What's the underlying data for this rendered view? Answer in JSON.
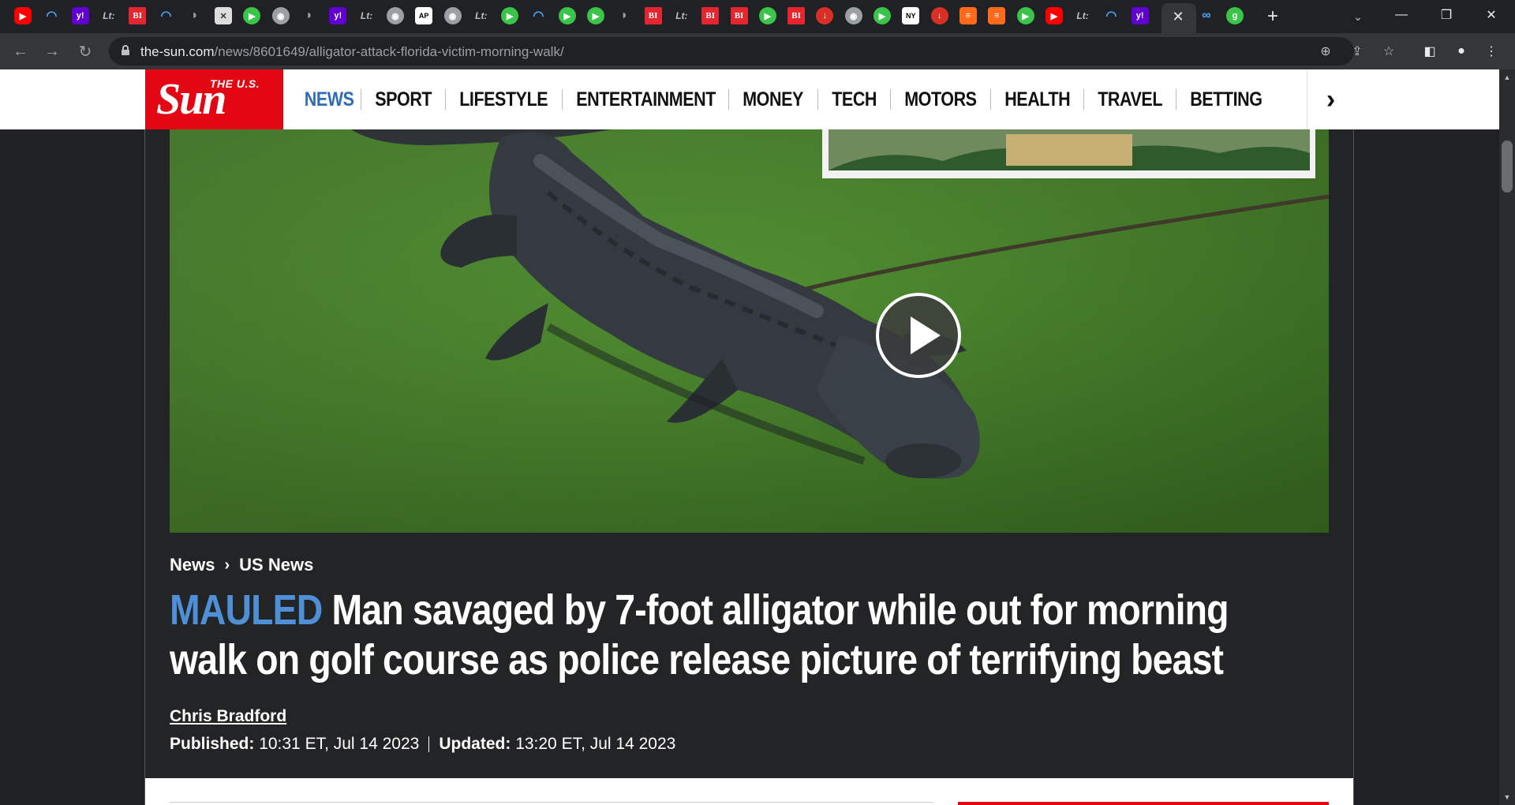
{
  "browser": {
    "url_host": "the-sun.com",
    "url_path": "/news/8601649/alligator-attack-florida-victim-morning-walk/",
    "tabs": [
      {
        "icon": "youtube-icon",
        "label": "▶",
        "cls": "fav-yt"
      },
      {
        "icon": "shield-icon",
        "label": "◠",
        "cls": "fav-shield"
      },
      {
        "icon": "yahoo-icon",
        "label": "y!",
        "cls": "fav-yahoo"
      },
      {
        "icon": "lt-icon",
        "label": "Lt:",
        "cls": "fav-text"
      },
      {
        "icon": "business-insider-icon",
        "label": "BI",
        "cls": "fav-bi"
      },
      {
        "icon": "shield-icon",
        "label": "◠",
        "cls": "fav-shield"
      },
      {
        "icon": "bird-icon",
        "label": "◗",
        "cls": "fav-bird"
      },
      {
        "icon": "image-icon",
        "label": "✕",
        "cls": "fav-x"
      },
      {
        "icon": "play-icon",
        "label": "▶",
        "cls": "fav-play"
      },
      {
        "icon": "globe-icon",
        "label": "◉",
        "cls": "fav-globe"
      },
      {
        "icon": "bird-icon",
        "label": "◗",
        "cls": "fav-bird"
      },
      {
        "icon": "yahoo-icon",
        "label": "y!",
        "cls": "fav-yahoo"
      },
      {
        "icon": "lt-icon",
        "label": "Lt:",
        "cls": "fav-text"
      },
      {
        "icon": "globe-icon",
        "label": "◉",
        "cls": "fav-globe"
      },
      {
        "icon": "ap-icon",
        "label": "AP",
        "cls": "fav-ap"
      },
      {
        "icon": "globe-icon",
        "label": "◉",
        "cls": "fav-globe"
      },
      {
        "icon": "lt-icon",
        "label": "Lt:",
        "cls": "fav-text"
      },
      {
        "icon": "play-icon",
        "label": "▶",
        "cls": "fav-play"
      },
      {
        "icon": "shield-icon",
        "label": "◠",
        "cls": "fav-shield"
      },
      {
        "icon": "play-icon",
        "label": "▶",
        "cls": "fav-play"
      },
      {
        "icon": "play-icon",
        "label": "▶",
        "cls": "fav-play"
      },
      {
        "icon": "bird-icon",
        "label": "◗",
        "cls": "fav-bird"
      },
      {
        "icon": "business-insider-icon",
        "label": "BI",
        "cls": "fav-bi"
      },
      {
        "icon": "lt-icon",
        "label": "Lt:",
        "cls": "fav-text"
      },
      {
        "icon": "business-insider-icon",
        "label": "BI",
        "cls": "fav-bi"
      },
      {
        "icon": "business-insider-icon",
        "label": "BI",
        "cls": "fav-bi"
      },
      {
        "icon": "play-icon",
        "label": "▶",
        "cls": "fav-play"
      },
      {
        "icon": "business-insider-icon",
        "label": "BI",
        "cls": "fav-bi"
      },
      {
        "icon": "mic-icon",
        "label": "↓",
        "cls": "fav-red"
      },
      {
        "icon": "globe-icon",
        "label": "◉",
        "cls": "fav-globe"
      },
      {
        "icon": "play-icon",
        "label": "▶",
        "cls": "fav-play"
      },
      {
        "icon": "nyt-icon",
        "label": "NY",
        "cls": "fav-ap"
      },
      {
        "icon": "mic-icon",
        "label": "↓",
        "cls": "fav-red"
      },
      {
        "icon": "bookmark-icon",
        "label": "≡",
        "cls": "fav-flag"
      },
      {
        "icon": "bookmark-icon",
        "label": "≡",
        "cls": "fav-flag"
      },
      {
        "icon": "play-icon",
        "label": "▶",
        "cls": "fav-play"
      },
      {
        "icon": "youtube-icon",
        "label": "▶",
        "cls": "fav-yt"
      },
      {
        "icon": "lt-icon",
        "label": "Lt:",
        "cls": "fav-text"
      },
      {
        "icon": "shield-icon",
        "label": "◠",
        "cls": "fav-shield"
      },
      {
        "icon": "yahoo-icon",
        "label": "y!",
        "cls": "fav-yahoo"
      }
    ],
    "after_tabs": [
      {
        "icon": "link-icon",
        "label": "∞",
        "cls": "fav-shield"
      },
      {
        "icon": "grammarly-icon",
        "label": "g",
        "cls": "fav-play"
      }
    ]
  },
  "site": {
    "logo_small": "THE U.S.",
    "logo_big": "Sun",
    "nav": [
      "NEWS",
      "SPORT",
      "LIFESTYLE",
      "ENTERTAINMENT",
      "MONEY",
      "TECH",
      "MOTORS",
      "HEALTH",
      "TRAVEL",
      "BETTING"
    ],
    "active_color": "#2f6db5",
    "brand_color": "#e30613"
  },
  "article": {
    "breadcrumb": [
      "News",
      "US News"
    ],
    "kicker": "MAULED",
    "headline": "Man savaged by 7-foot alligator while out for morning walk on golf course as police release picture of terrifying beast",
    "author": "Chris Bradford",
    "published_label": "Published:",
    "published_value": "10:31 ET, Jul 14 2023",
    "updated_label": "Updated:",
    "updated_value": "13:20 ET, Jul 14 2023",
    "kicker_color": "#4f8fd6"
  }
}
